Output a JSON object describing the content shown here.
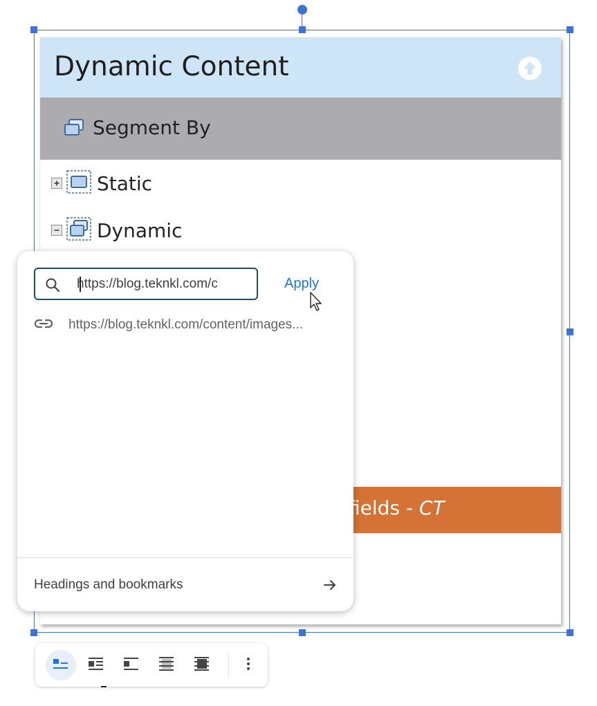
{
  "image": {
    "title": "Dynamic Content",
    "segment_label": "Segment By",
    "tree": [
      {
        "label": "Static",
        "expander": "plus"
      },
      {
        "label": "Dynamic",
        "expander": "minus"
      }
    ],
    "orange_bar_text": "fields - ",
    "orange_bar_italic": "CT"
  },
  "link_popup": {
    "search_value": "https://blog.teknkl.com/c",
    "apply_label": "Apply",
    "suggestion_text": "https://blog.teknkl.com/content/images...",
    "headings_label": "Headings and bookmarks"
  },
  "toolbar": {
    "buttons": [
      "inline",
      "wrap-text",
      "break-text",
      "behind-text",
      "in-front-of-text",
      "more-options"
    ],
    "active": "inline"
  },
  "colors": {
    "selection": "#3b74d4",
    "header_bg": "#cde5f7",
    "segment_bg": "#ababb0",
    "orange": "#d47335",
    "link": "#1a73e8"
  }
}
